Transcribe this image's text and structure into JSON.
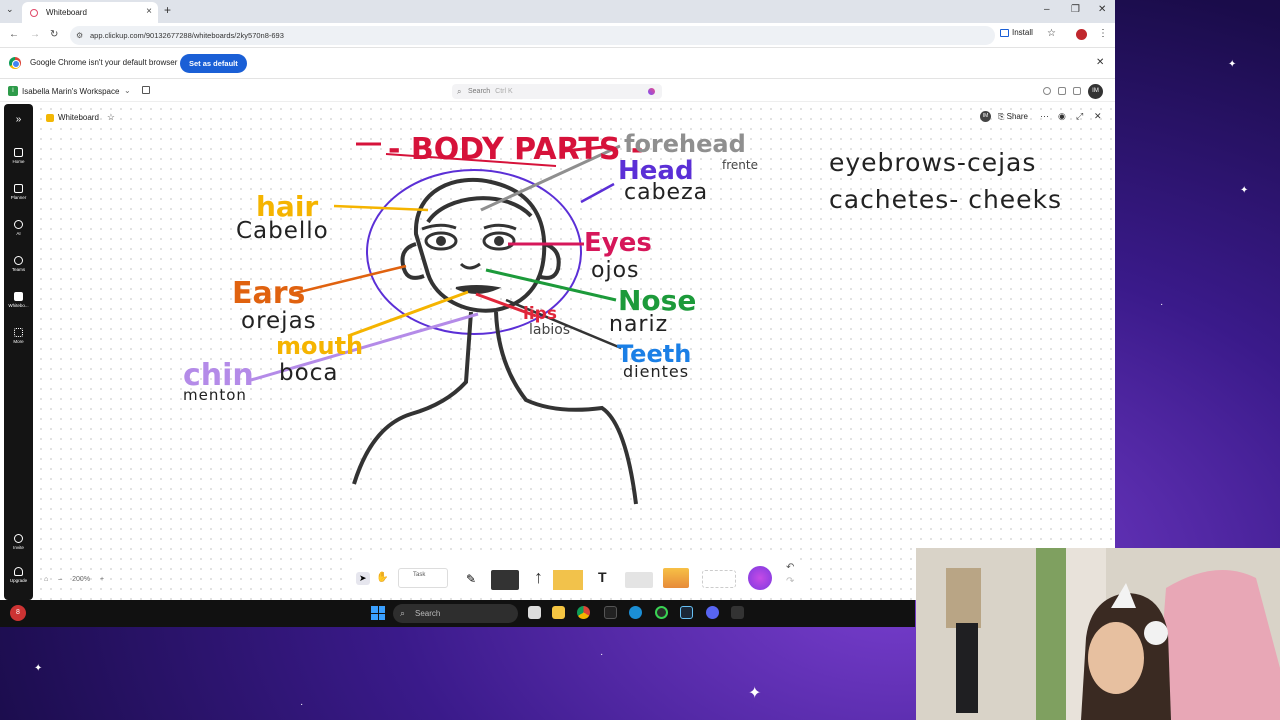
{
  "browser": {
    "tab_title": "Whiteboard",
    "url": "app.clickup.com/90132677288/whiteboards/2ky570n8-693",
    "install_label": "Install",
    "infobar_text": "Google Chrome isn't your default browser",
    "infobar_button": "Set as default"
  },
  "clickup": {
    "workspace_avatar": "I",
    "workspace_name": "Isabella Marin's Workspace",
    "search_placeholder": "Search",
    "search_shortcut": "Ctrl K",
    "user_initials": "IM",
    "sidebar": [
      {
        "label": "Home",
        "icon": "home-icon"
      },
      {
        "label": "Planner",
        "icon": "calendar-icon"
      },
      {
        "label": "AI",
        "icon": "ai-icon"
      },
      {
        "label": "Teams",
        "icon": "people-icon"
      },
      {
        "label": "Whitebo...",
        "icon": "whiteboard-icon"
      },
      {
        "label": "More",
        "icon": "grid-icon"
      }
    ],
    "sidebar_bottom": [
      {
        "label": "Invite",
        "icon": "invite-icon"
      },
      {
        "label": "Upgrade",
        "icon": "upgrade-icon"
      }
    ]
  },
  "whiteboard": {
    "title": "Whiteboard",
    "share_label": "Share",
    "share_initials": "IM",
    "zoom_level": "200%",
    "toolbar_task_label": "Task",
    "notes": [
      "eyebrows-cejas",
      "cachetes- cheeks"
    ],
    "labels": {
      "title": "- BODY PARTS -",
      "forehead": "forehead",
      "frente": "frente",
      "head": "Head",
      "cabeza": "cabeza",
      "hair": "hair",
      "cabello": "Cabello",
      "eyes": "Eyes",
      "ojos": "ojos",
      "ears": "Ears",
      "orejas": "orejas",
      "nose": "Nose",
      "nariz": "nariz",
      "mouth": "mouth",
      "boca": "boca",
      "lips": "lips",
      "labios": "labios",
      "chin": "chin",
      "menton": "menton",
      "teeth": "Teeth",
      "dientes": "dientes"
    },
    "colors": {
      "title": "#d6123a",
      "hair": "#f5b400",
      "head": "#5b2fd6",
      "eyes": "#d6175a",
      "ears": "#e0620f",
      "nose": "#1c9a3a",
      "mouth": "#f5b400",
      "chin": "#b48be8",
      "teeth": "#1a7fe6",
      "forehead": "#8f8f8f",
      "lips": "#e0263a"
    }
  },
  "taskbar": {
    "search_placeholder": "Search",
    "notification_count": "8"
  }
}
